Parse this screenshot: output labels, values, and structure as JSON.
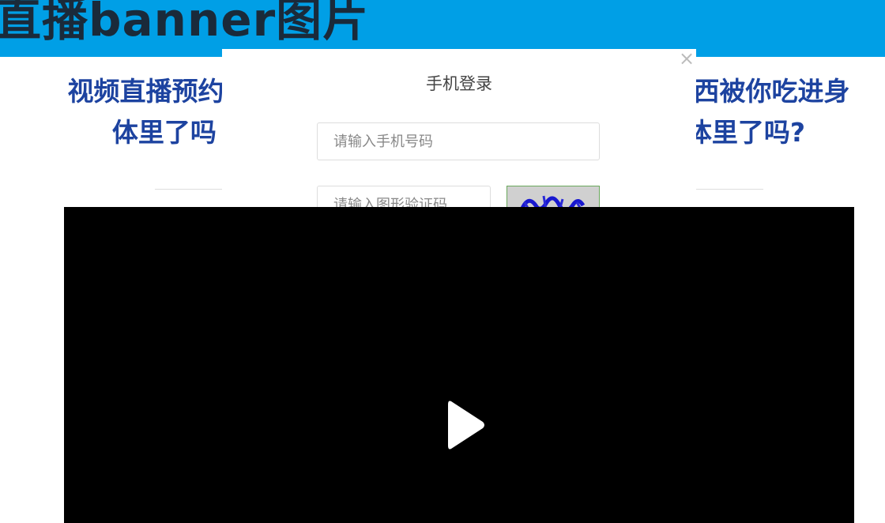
{
  "banner": {
    "text": "直播banner图片"
  },
  "article": {
    "title_line1": "视频直播预约",
    "title_line1_end": "西被你吃进身",
    "title_line2_start": "体里了吗",
    "title_line2_end": "体里了吗?"
  },
  "login_modal": {
    "title": "手机登录",
    "phone_placeholder": "请输入手机号码",
    "captcha_placeholder": "请输入图形验证码",
    "close_icon": "close-icon"
  },
  "video": {
    "play_icon": "play-icon"
  },
  "colors": {
    "banner_bg": "#009fe6",
    "title": "#1d43a0",
    "video_bg": "#000000"
  }
}
